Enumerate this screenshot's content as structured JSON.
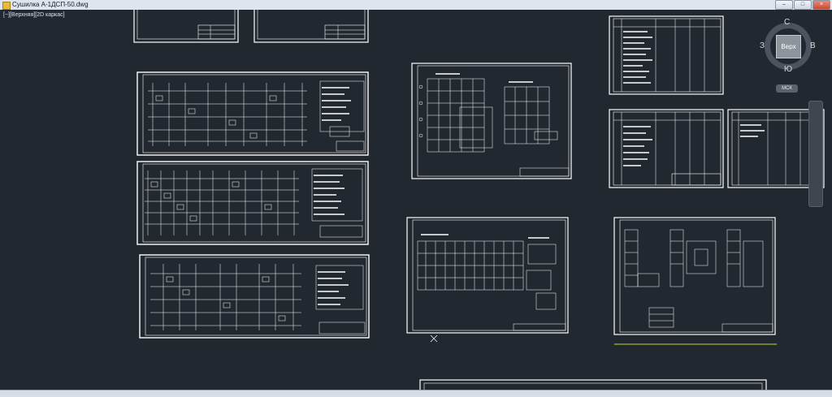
{
  "window": {
    "title": "Сушилка А-1ДСП-50.dwg",
    "app_icon": "autocad-file-icon"
  },
  "viewport": {
    "label": "[−][Верхняя][2D каркас]"
  },
  "viewcube": {
    "face": "Верх",
    "north": "С",
    "south": "Ю",
    "west": "З",
    "east": "В",
    "wcs_label": "МСК"
  },
  "colors": {
    "background": "#212830",
    "line": "#ffffff",
    "accent_line": "#c8d43a"
  },
  "sheets": [
    {
      "name": "frame-top-left-1",
      "kind": "partial"
    },
    {
      "name": "frame-top-left-2",
      "kind": "partial"
    },
    {
      "name": "schematic-1",
      "kind": "schematic"
    },
    {
      "name": "schematic-2",
      "kind": "schematic"
    },
    {
      "name": "schematic-3",
      "kind": "schematic"
    },
    {
      "name": "floor-plan-1",
      "kind": "plan"
    },
    {
      "name": "floor-plan-2",
      "kind": "plan"
    },
    {
      "name": "floor-plan-3",
      "kind": "plan"
    },
    {
      "name": "specification-1",
      "kind": "table"
    },
    {
      "name": "specification-2",
      "kind": "table"
    },
    {
      "name": "specification-3",
      "kind": "table"
    },
    {
      "name": "frame-bottom",
      "kind": "partial"
    }
  ]
}
